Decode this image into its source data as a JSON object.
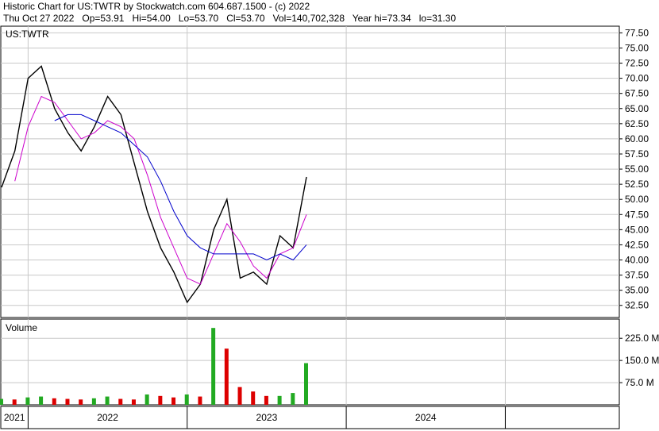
{
  "header": {
    "line1": "Historic Chart for US:TWTR by Stockwatch.com 604.687.1500 - (c) 2022",
    "line2": "Thu Oct 27 2022   Op=53.91   Hi=54.00   Lo=53.70   Cl=53.70   Vol=140,702,328   Year hi=73.34   lo=31.30"
  },
  "colors": {
    "price": "#000000",
    "ma_short": "#cc00cc",
    "ma_long": "#0000cc",
    "vol_up": "#22aa22",
    "vol_down": "#dd0000",
    "grid": "#c8c8c8"
  },
  "chart_data": [
    {
      "type": "line",
      "panel": "price",
      "label": "US:TWTR",
      "x_ticks": [
        "2021",
        "2022",
        "2023",
        "2024"
      ],
      "y_ticks": [
        "77.50",
        "75.00",
        "72.50",
        "70.00",
        "67.50",
        "65.00",
        "62.50",
        "60.00",
        "57.50",
        "55.00",
        "52.50",
        "50.00",
        "47.50",
        "45.00",
        "42.50",
        "40.00",
        "37.50",
        "35.00",
        "32.50"
      ],
      "ylim": [
        30.5,
        78.6
      ],
      "grid": true,
      "series": [
        {
          "role": "price",
          "x": [
            "2020-11",
            "2020-12",
            "2021-01",
            "2021-02",
            "2021-03",
            "2021-04",
            "2021-05",
            "2021-06",
            "2021-07",
            "2021-08",
            "2021-09",
            "2021-10",
            "2021-11",
            "2021-12",
            "2022-01",
            "2022-02",
            "2022-03",
            "2022-04",
            "2022-05",
            "2022-06",
            "2022-07",
            "2022-08",
            "2022-09",
            "2022-10"
          ],
          "values": [
            52,
            58,
            70,
            72,
            65,
            61,
            58,
            62,
            67,
            64,
            56,
            48,
            42,
            38,
            33,
            36,
            45,
            50,
            37,
            38,
            36,
            44,
            42,
            53.7
          ]
        },
        {
          "role": "ma_short",
          "values": [
            null,
            53,
            62,
            67,
            66,
            63,
            60,
            61,
            63,
            62,
            60,
            54,
            47,
            42,
            37,
            36,
            41,
            46,
            43,
            39,
            37,
            41,
            42,
            47.5
          ]
        },
        {
          "role": "ma_long",
          "values": [
            null,
            null,
            null,
            null,
            63,
            64,
            64,
            63,
            62,
            61,
            59,
            57,
            53,
            48,
            44,
            42,
            41,
            41,
            41,
            41,
            40,
            41,
            40,
            42.5
          ]
        }
      ]
    },
    {
      "type": "bar",
      "panel": "volume",
      "label": "Volume",
      "y_ticks": [
        "225.0 M",
        "150.0 M",
        "75.0 M"
      ],
      "ylim": [
        0,
        290
      ],
      "x": [
        "2020-11",
        "2020-12",
        "2021-01",
        "2021-02",
        "2021-03",
        "2021-04",
        "2021-05",
        "2021-06",
        "2021-07",
        "2021-08",
        "2021-09",
        "2021-10",
        "2021-11",
        "2021-12",
        "2022-01",
        "2022-02",
        "2022-03",
        "2022-04",
        "2022-05",
        "2022-06",
        "2022-07",
        "2022-08",
        "2022-09",
        "2022-10"
      ],
      "values": [
        20,
        18,
        25,
        28,
        22,
        20,
        18,
        22,
        28,
        20,
        18,
        35,
        30,
        25,
        35,
        28,
        260,
        190,
        60,
        45,
        30,
        30,
        40,
        141
      ]
    }
  ]
}
